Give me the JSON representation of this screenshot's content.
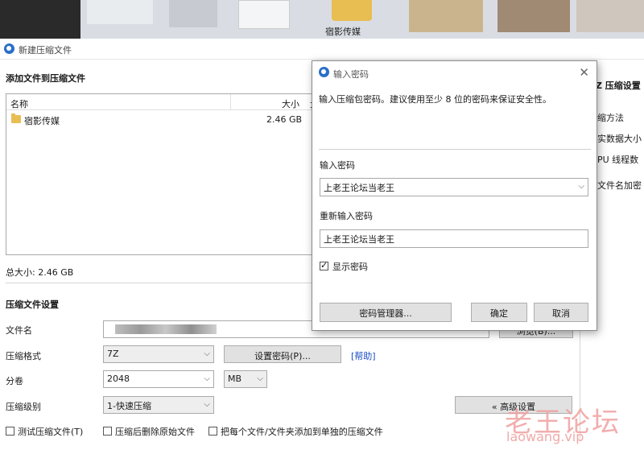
{
  "desktop": {
    "folder_label": "宿影传媒"
  },
  "window": {
    "title": "新建压缩文件"
  },
  "add_files": {
    "heading": "添加文件到压缩文件",
    "col_name": "名称",
    "col_size": "大小",
    "col_third": "大",
    "rows": [
      {
        "name": "宿影传媒",
        "size": "2.46 GB"
      }
    ],
    "total": "总大小: 2.46 GB"
  },
  "settings": {
    "heading": "压缩文件设置",
    "filename_label": "文件名",
    "browse_label": "浏览(B)...",
    "format_label": "压缩格式",
    "format_value": "7Z",
    "set_password_label": "设置密码(P)...",
    "help_link": "[帮助]",
    "split_label": "分卷",
    "split_value": "2048",
    "split_unit": "MB",
    "level_label": "压缩级别",
    "level_value": "1-快速压缩",
    "advanced_label": "« 高级设置",
    "test_label": "测试压缩文件(T)",
    "delete_label": "压缩后删除原始文件",
    "separate_label": "把每个文件/文件夹添加到单独的压缩文件"
  },
  "right_panel": {
    "heading": "Z 压缩设置",
    "method": "缩方法",
    "dict": "实数据大小",
    "threads": "PU 线程数",
    "encrypt": "文件名加密"
  },
  "dialog": {
    "title": "输入密码",
    "hint": "输入压缩包密码。建议使用至少 8 位的密码来保证安全性。",
    "enter_label": "输入密码",
    "enter_value": "上老王论坛当老王",
    "reenter_label": "重新输入密码",
    "reenter_value": "上老王论坛当老王",
    "show_password": "显示密码",
    "manager_btn": "密码管理器...",
    "ok_btn": "确定",
    "cancel_btn": "取消"
  },
  "watermark": {
    "text": "老王论坛",
    "url": "laowang.vip"
  }
}
